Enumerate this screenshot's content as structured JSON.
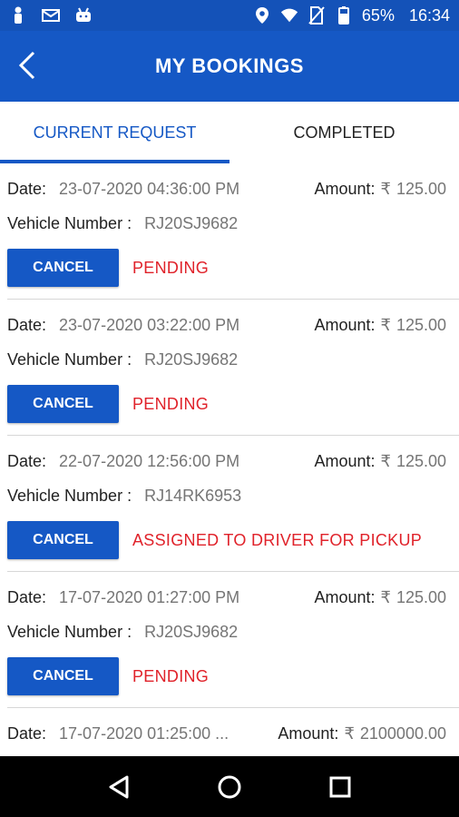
{
  "status_bar": {
    "battery": "65%",
    "time": "16:34"
  },
  "app_bar": {
    "title": "MY BOOKINGS"
  },
  "tabs": [
    {
      "label": "CURRENT REQUEST",
      "active": true
    },
    {
      "label": "COMPLETED",
      "active": false
    }
  ],
  "labels": {
    "date": "Date:",
    "amount": "Amount:",
    "vehicle": "Vehicle Number :",
    "currency": "₹",
    "cancel": "CANCEL"
  },
  "bookings": [
    {
      "date": "23-07-2020 04:36:00 PM",
      "amount": "125.00",
      "vehicle": "RJ20SJ9682",
      "status": "PENDING"
    },
    {
      "date": "23-07-2020 03:22:00 PM",
      "amount": "125.00",
      "vehicle": "RJ20SJ9682",
      "status": "PENDING"
    },
    {
      "date": "22-07-2020 12:56:00 PM",
      "amount": "125.00",
      "vehicle": "RJ14RK6953",
      "status": "ASSIGNED TO DRIVER FOR PICKUP"
    },
    {
      "date": "17-07-2020 01:27:00 PM",
      "amount": "125.00",
      "vehicle": "RJ20SJ9682",
      "status": "PENDING"
    },
    {
      "date": "17-07-2020 01:25:00 ...",
      "amount": "2100000.00",
      "vehicle": "",
      "status": ""
    }
  ],
  "colors": {
    "primary": "#1558c5",
    "status_red": "#e0222a"
  }
}
